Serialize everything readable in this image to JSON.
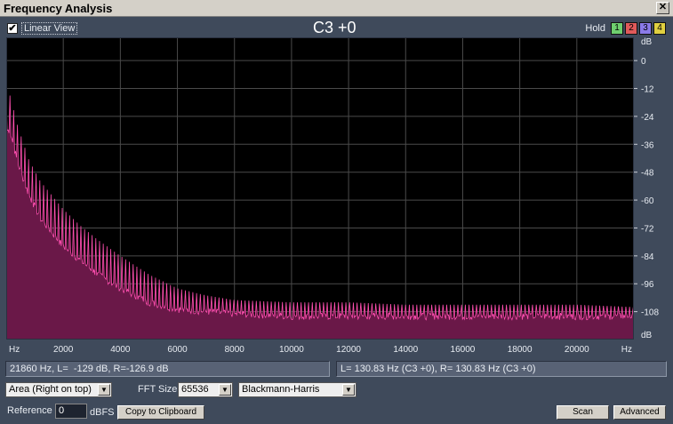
{
  "window": {
    "title": "Frequency Analysis",
    "close_glyph": "✕"
  },
  "toolbar": {
    "linear_view_label": "Linear View",
    "linear_view_checked": true,
    "check_glyph": "✔",
    "note_display": "C3 +0",
    "hold_label": "Hold",
    "hold_buttons": [
      {
        "label": "1",
        "color": "#6fcf6f"
      },
      {
        "label": "2",
        "color": "#e05a5a"
      },
      {
        "label": "3",
        "color": "#8a7ae8"
      },
      {
        "label": "4",
        "color": "#e0d040"
      }
    ]
  },
  "chart_data": {
    "type": "area",
    "title": "",
    "xlabel": "Hz",
    "ylabel": "dB",
    "xlim": [
      0,
      22000
    ],
    "ylim": [
      -120,
      10
    ],
    "x_ticks": [
      2000,
      4000,
      6000,
      8000,
      10000,
      12000,
      14000,
      16000,
      18000,
      20000
    ],
    "x_tick_labels": [
      "2000",
      "4000",
      "6000",
      "8000",
      "10000",
      "12000",
      "14000",
      "16000",
      "18000",
      "20000"
    ],
    "x_unit_left": "Hz",
    "x_unit_right": "Hz",
    "y_ticks": [
      0,
      -12,
      -24,
      -36,
      -48,
      -60,
      -72,
      -84,
      -96,
      -108
    ],
    "y_tick_labels": [
      "0",
      "-12",
      "-24",
      "-36",
      "-48",
      "-60",
      "-72",
      "-84",
      "-96",
      "-108"
    ],
    "y_unit_top": "dB",
    "y_unit_bottom": "dB",
    "grid": true,
    "fundamental_hz": 130.83,
    "series": [
      {
        "name": "",
        "x": [
          130,
          400,
          800,
          1200,
          1600,
          2000,
          2600,
          3200,
          4000,
          5000,
          6000,
          7000,
          8000,
          10000,
          12000,
          14000,
          16000,
          18000,
          20000,
          22000
        ],
        "peak": [
          -15,
          -28,
          -43,
          -52,
          -58,
          -64,
          -71,
          -77,
          -84,
          -92,
          -98,
          -101,
          -103,
          -104,
          -104,
          -105,
          -105,
          -105,
          -105,
          -106
        ],
        "floor": [
          -30,
          -44,
          -58,
          -68,
          -74,
          -80,
          -86,
          -92,
          -98,
          -104,
          -107,
          -108,
          -109,
          -110,
          -110,
          -110,
          -110,
          -110,
          -110,
          -110
        ]
      }
    ],
    "colors": {
      "fill": "#6a1848",
      "line": "#ff4fb0",
      "background": "#000000",
      "grid": "#4a4a4a"
    }
  },
  "status": {
    "cursor": "21860 Hz, L=  -129 dB, R=-126.9 dB",
    "peak": "L= 130.83 Hz (C3 +0), R= 130.83 Hz (C3 +0)"
  },
  "controls": {
    "view_mode": "Area (Right on top)",
    "fft_size_label": "FFT Size",
    "fft_size": "65536",
    "window_fn": "Blackmann-Harris",
    "reference_label": "Reference",
    "reference_value": "0",
    "reference_unit": "dBFS",
    "copy_button": "Copy to Clipboard",
    "scan_button": "Scan",
    "advanced_button": "Advanced",
    "dropdown_glyph": "▼"
  }
}
